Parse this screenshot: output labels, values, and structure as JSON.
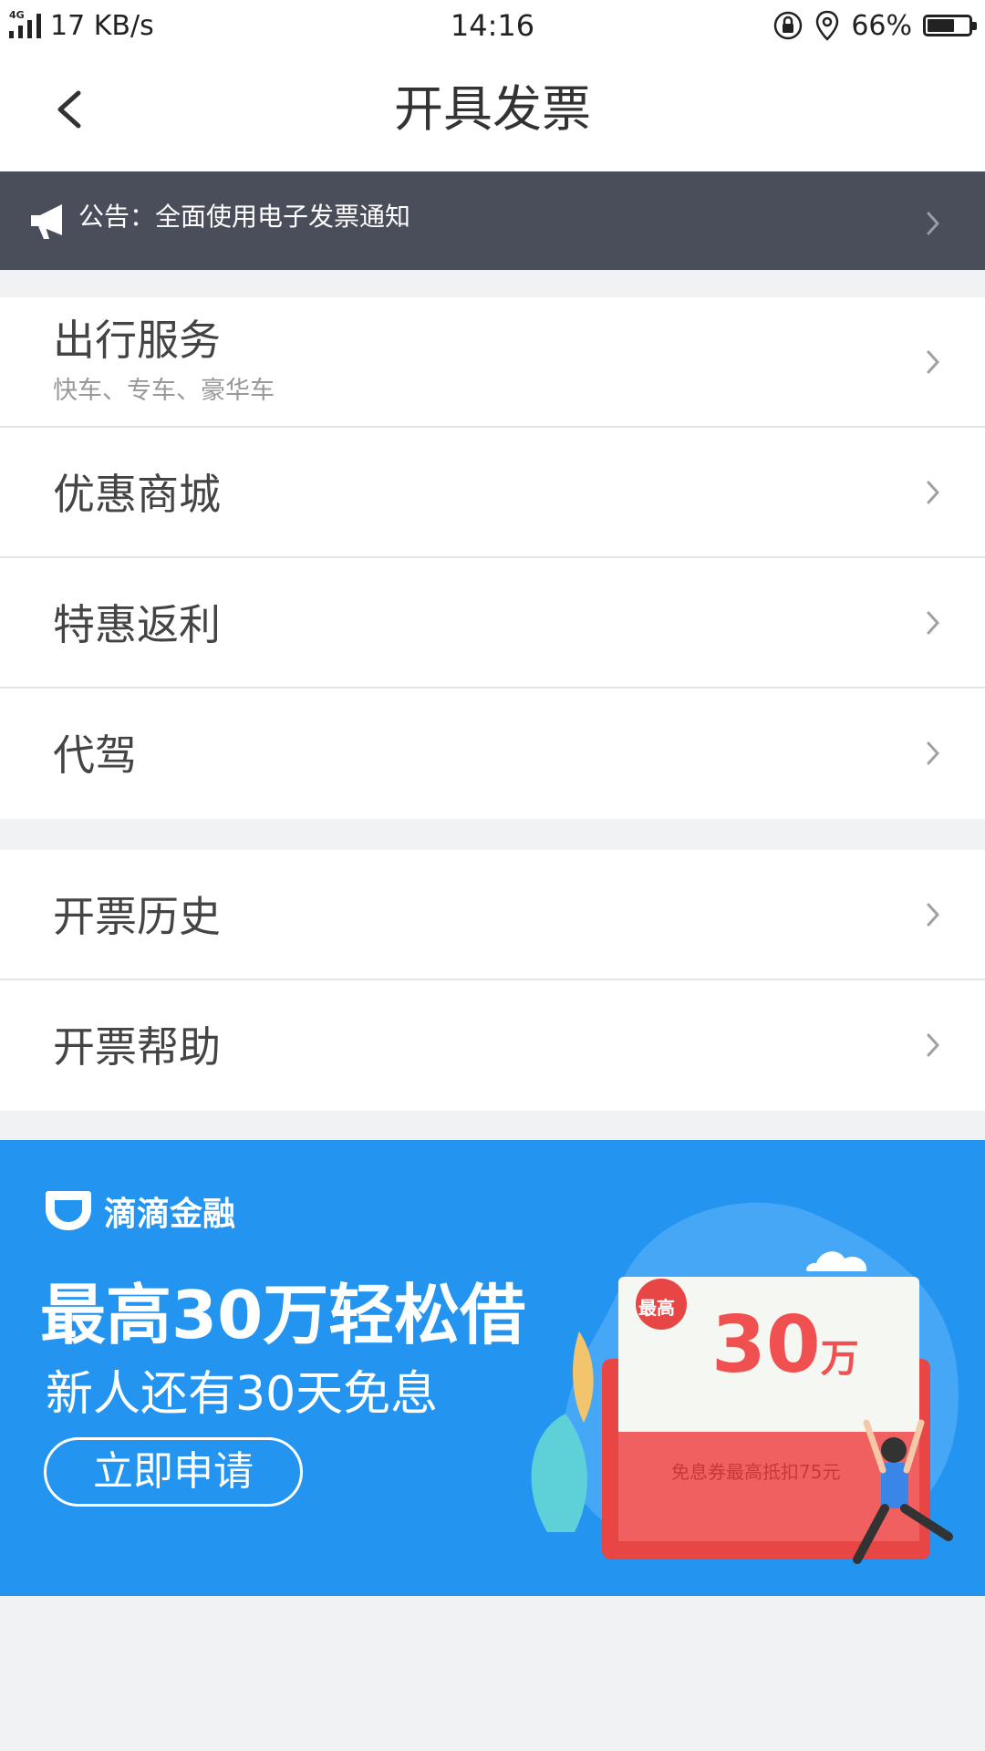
{
  "status_bar": {
    "network": "4G",
    "speed": "17 KB/s",
    "time": "14:16",
    "battery": "66%",
    "battery_level": 0.66
  },
  "header": {
    "title": "开具发票",
    "back_icon": "chevron-left-icon"
  },
  "notice": {
    "text": "公告：全面使用电子发票通知",
    "icon": "megaphone-icon"
  },
  "invoice_types": [
    {
      "label": "出行服务",
      "sub": "快车、专车、豪华车"
    },
    {
      "label": "优惠商城"
    },
    {
      "label": "特惠返利"
    },
    {
      "label": "代驾"
    }
  ],
  "invoice_tools": [
    {
      "label": "开票历史"
    },
    {
      "label": "开票帮助"
    }
  ],
  "banner": {
    "brand": "滴滴金融",
    "title": "最高30万轻松借",
    "subtitle": "新人还有30天免息",
    "button": "立即申请",
    "card_badge": "最高",
    "card_amount": "30",
    "card_unit": "万",
    "card_note": "免息券最高抵扣75元"
  },
  "colors": {
    "notice_bg": "#4a4d5a",
    "banner_bg": "#2395f0",
    "page_bg": "#f1f2f4"
  }
}
